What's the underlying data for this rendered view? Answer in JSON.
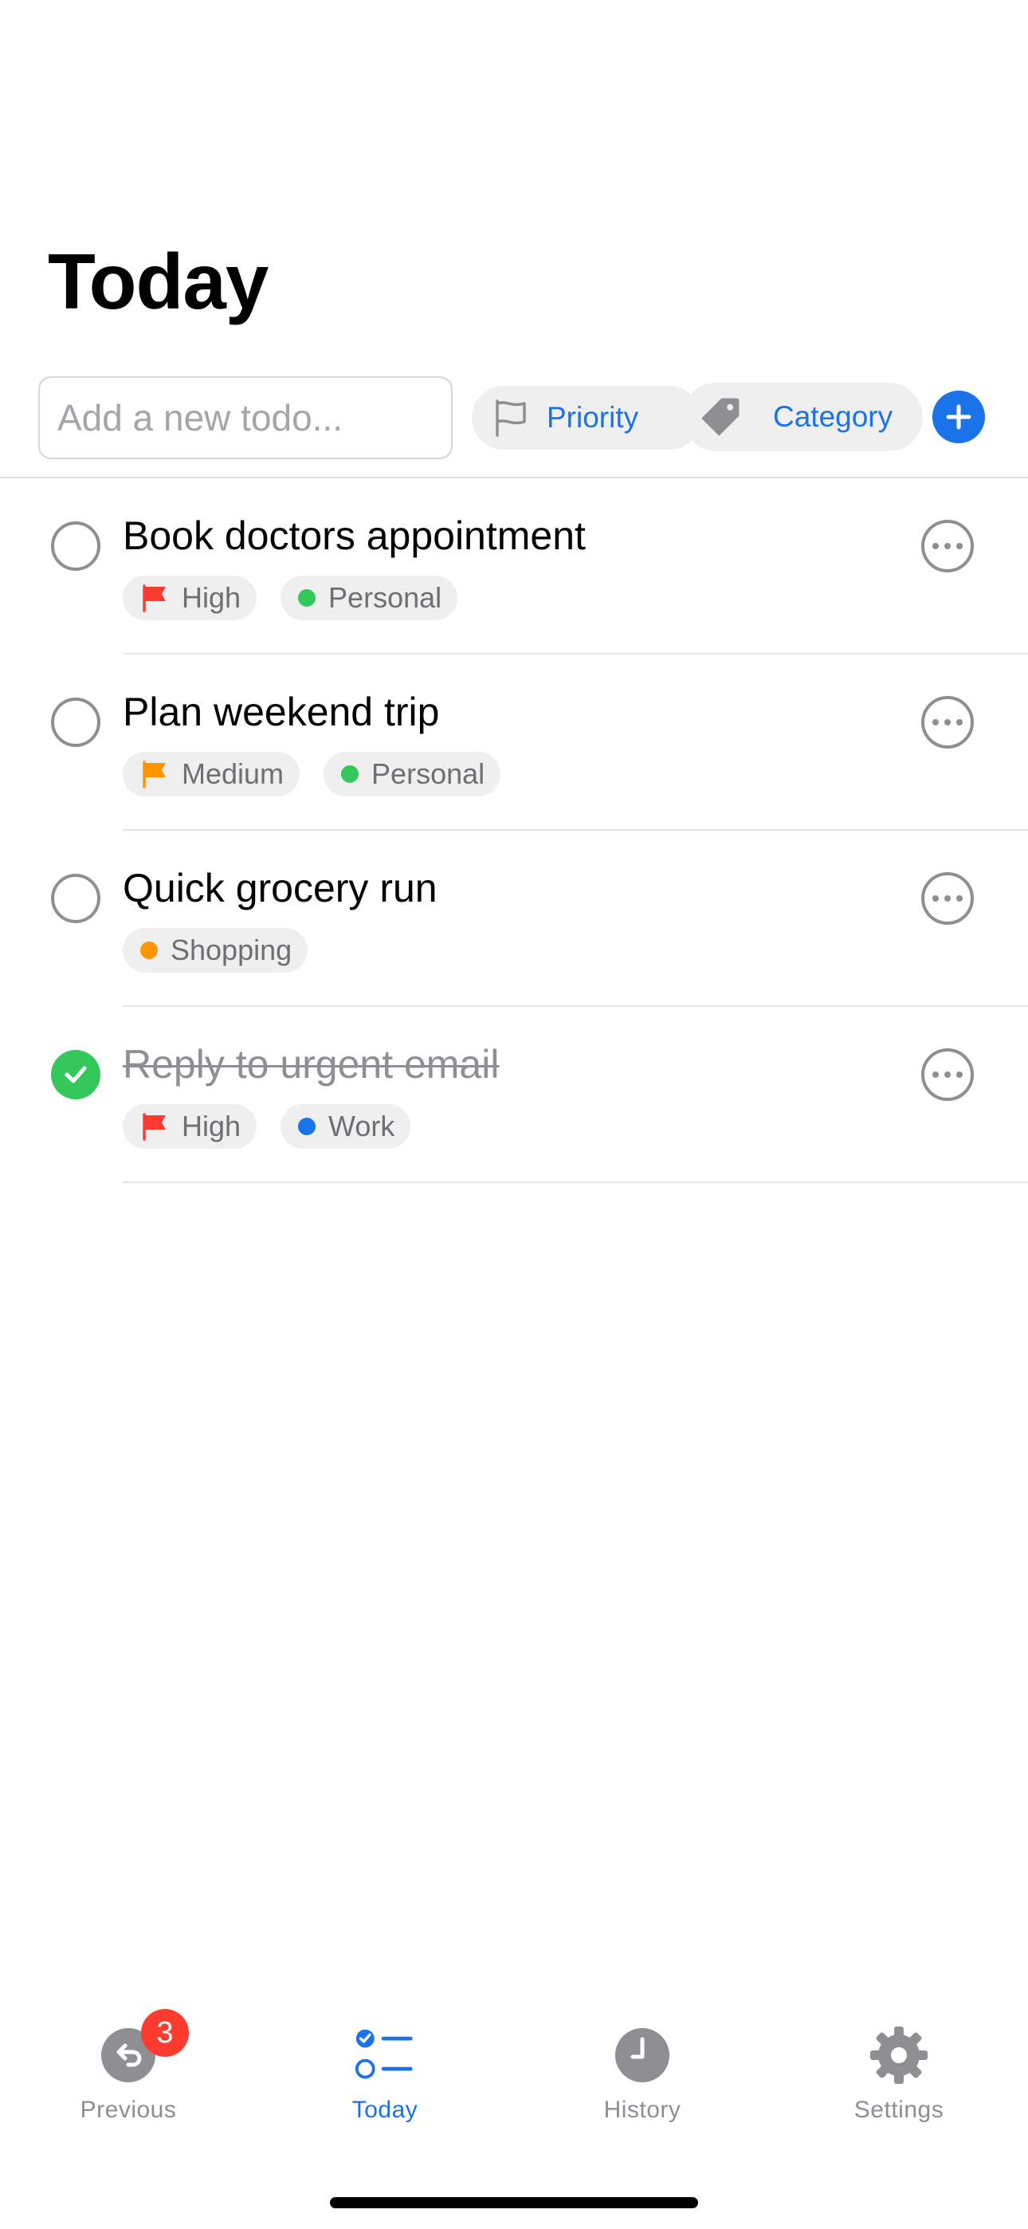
{
  "page": {
    "title": "Today"
  },
  "toolbar": {
    "input_placeholder": "Add a new todo...",
    "priority_label": "Priority",
    "category_label": "Category"
  },
  "todos": [
    {
      "title": "Book doctors appointment",
      "completed": false,
      "priority": {
        "label": "High",
        "color": "#ff3b30"
      },
      "category": {
        "label": "Personal",
        "color": "#34c759"
      }
    },
    {
      "title": "Plan weekend trip",
      "completed": false,
      "priority": {
        "label": "Medium",
        "color": "#ff9500"
      },
      "category": {
        "label": "Personal",
        "color": "#34c759"
      }
    },
    {
      "title": "Quick grocery run",
      "completed": false,
      "priority": null,
      "category": {
        "label": "Shopping",
        "color": "#ff9500"
      }
    },
    {
      "title": "Reply to urgent email",
      "completed": true,
      "priority": {
        "label": "High",
        "color": "#ff3b30"
      },
      "category": {
        "label": "Work",
        "color": "#1a73e8"
      }
    }
  ],
  "tabbar": {
    "previous_label": "Previous",
    "previous_badge": "3",
    "today_label": "Today",
    "history_label": "History",
    "settings_label": "Settings"
  },
  "colors": {
    "accent": "#1a73e8",
    "gray": "#8e8e93",
    "pill_bg": "#efeff0",
    "done_green": "#34c759",
    "badge_red": "#ff3b30"
  },
  "icons": {
    "priority": "flag-outline-icon",
    "category": "tag-icon",
    "add": "plus-circle-icon",
    "more": "ellipsis-circle-icon",
    "previous": "return-arrow-icon",
    "today": "checklist-icon",
    "history": "clock-icon",
    "settings": "gear-icon"
  }
}
